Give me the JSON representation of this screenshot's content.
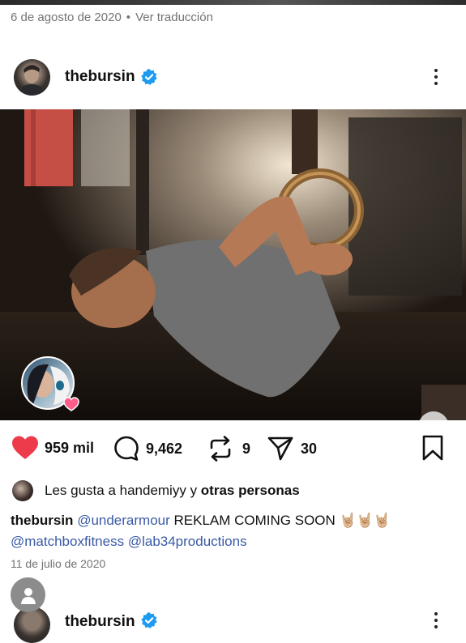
{
  "top": {
    "date": "6 de agosto de 2020",
    "separator": "•",
    "translate_link": "Ver traducción"
  },
  "post": {
    "username": "thebursin",
    "verified_icon": "verified-badge-icon",
    "more_icon": "more-vertical-icon",
    "image_alt": "Man doing gymnastic ring push-ups in gym",
    "next_icon": "chevron-right-icon",
    "tagged_badge_icon": "heart-icon",
    "actions": {
      "likes": "959 mil",
      "comments": "9,462",
      "reposts": "9",
      "shares": "30"
    },
    "liked_by": {
      "prefix": "Les gusta a ",
      "user": "handemiyy",
      "middle": " y ",
      "others": "otras personas"
    },
    "caption": {
      "author": "thebursin",
      "mention1": "@underarmour",
      "text": " REKLAM COMING SOON ",
      "emoji": "🤘🏼🤘🏼🤘🏼",
      "mention2": "@matchboxfitness",
      "mention3": "@lab34productions"
    },
    "date": "11 de julio de 2020"
  },
  "next_post": {
    "username": "thebursin"
  },
  "colors": {
    "like_red": "#ed3b4b",
    "verified_blue": "#1d9bf0",
    "mention_blue": "#3a5aa6",
    "muted_gray": "#737373"
  }
}
